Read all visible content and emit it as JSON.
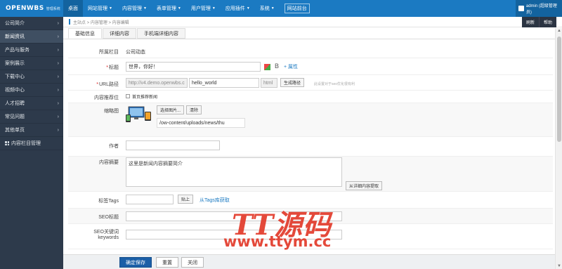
{
  "app": {
    "logo": "OPENWBS",
    "logo_sub": "管理系统"
  },
  "topnav": [
    {
      "label": "桌面",
      "dropdown": false,
      "active": true
    },
    {
      "label": "网站管理",
      "dropdown": true
    },
    {
      "label": "内容管理",
      "dropdown": true
    },
    {
      "label": "表单管理",
      "dropdown": true
    },
    {
      "label": "用户管理",
      "dropdown": true
    },
    {
      "label": "应用插件",
      "dropdown": true
    },
    {
      "label": "系统",
      "dropdown": true
    },
    {
      "label": "网站前台",
      "dropdown": false
    }
  ],
  "admin": {
    "label": "admin (超级管理员)"
  },
  "sidebar": {
    "items": [
      {
        "label": "公司简介"
      },
      {
        "label": "新闻资讯"
      },
      {
        "label": "产品与服务"
      },
      {
        "label": "案例展示"
      },
      {
        "label": "下载中心"
      },
      {
        "label": "视频中心"
      },
      {
        "label": "人才招聘"
      },
      {
        "label": "常见问题"
      },
      {
        "label": "其他单页"
      },
      {
        "label": "内容栏目管理"
      }
    ]
  },
  "breadcrumb": "主站点 > 内容管理 > 内容编辑",
  "crumb_actions": {
    "refresh": "刷新",
    "help": "帮助"
  },
  "tabs": [
    "基础信息",
    "详细内容",
    "手机端详细内容"
  ],
  "form": {
    "column": {
      "label": "所属栏目",
      "value": "公司动态"
    },
    "title": {
      "label": "标题",
      "value": "世界，你好！",
      "bold": "B",
      "more": "+ 属性"
    },
    "url": {
      "label": "URL路径",
      "prefix": "http://v4.demo.openwbs.c",
      "value": "hello_world",
      "suffix": "html",
      "gen_button": "生成路径",
      "hint": "此设置对于seo优化很有利"
    },
    "recommend": {
      "label": "内容推荐位",
      "option": "首页推荐新闻"
    },
    "thumb": {
      "label": "缩略图",
      "select_button": "选择图片...",
      "clear_button": "清除",
      "path": "/ow-content/uploads/news/thu"
    },
    "author": {
      "label": "作者",
      "value": ""
    },
    "summary": {
      "label": "内容摘要",
      "value": "这里是新闻内容摘要简介",
      "extract_button": "从详细内容提取"
    },
    "tags": {
      "label": "标签Tags",
      "value": "",
      "paste_button": "贴上",
      "fetch_link": "从Tags库获取"
    },
    "seo_title": {
      "label": "SEO标题",
      "value": ""
    },
    "seo_keywords": {
      "label": "SEO关键词",
      "label2": "keywords",
      "value": ""
    }
  },
  "bottom": {
    "save": "确定保存",
    "reset": "重置",
    "close": "关闭"
  },
  "watermark": {
    "title": "TT源码",
    "url": "www.ttym.cc"
  },
  "colors": {
    "topbar": "#1b7ac2",
    "sidebar": "#2d3a4b",
    "primary_button": "#1b5fa7",
    "watermark": "#e23a2a"
  }
}
